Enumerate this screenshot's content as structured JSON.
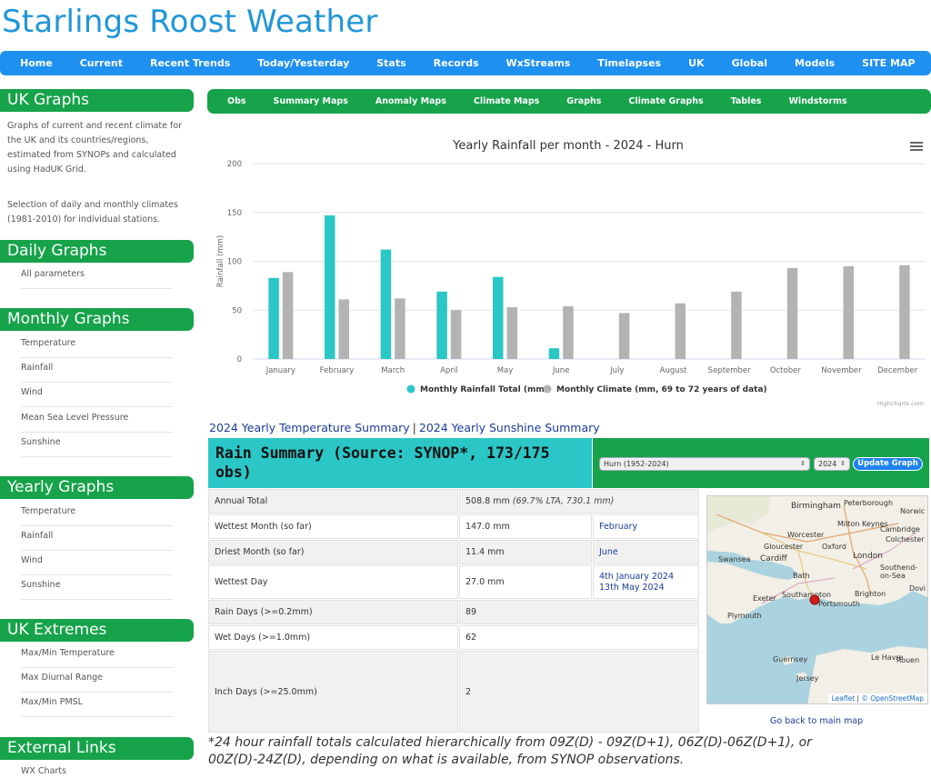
{
  "site_title": "Starlings Roost Weather",
  "topnav": [
    "Home",
    "Current",
    "Recent Trends",
    "Today/Yesterday",
    "Stats",
    "Records",
    "WxStreams",
    "Timelapses",
    "UK",
    "Global",
    "Models",
    "SITE MAP"
  ],
  "sidebar": {
    "uk_graphs": {
      "heading": "UK Graphs",
      "text1": "Graphs of current and recent climate for the UK and its countries/regions, estimated from SYNOPs and calculated using HadUK Grid.",
      "text2": "Selection of daily and monthly climates (1981-2010) for individual stations."
    },
    "daily": {
      "heading": "Daily Graphs",
      "items": [
        "All parameters"
      ]
    },
    "monthly": {
      "heading": "Monthly Graphs",
      "items": [
        "Temperature",
        "Rainfall",
        "Wind",
        "Mean Sea Level Pressure",
        "Sunshine"
      ]
    },
    "yearly": {
      "heading": "Yearly Graphs",
      "items": [
        "Temperature",
        "Rainfall",
        "Wind",
        "Sunshine"
      ]
    },
    "extremes": {
      "heading": "UK Extremes",
      "items": [
        "Max/Min Temperature",
        "Max Diurnal Range",
        "Max/Min PMSL"
      ]
    },
    "external": {
      "heading": "External Links",
      "items": [
        "WX Charts"
      ]
    }
  },
  "subnav": [
    "Obs",
    "Summary Maps",
    "Anomaly Maps",
    "Climate Maps",
    "Graphs",
    "Climate Graphs",
    "Tables",
    "Windstorms"
  ],
  "chart_data": {
    "type": "bar",
    "title": "Yearly Rainfall per month - 2024 - Hurn",
    "ylabel": "Rainfall (mm)",
    "xlabel": "",
    "ylim": [
      0,
      200
    ],
    "yticks": [
      0,
      50,
      100,
      150,
      200
    ],
    "categories": [
      "January",
      "February",
      "March",
      "April",
      "May",
      "June",
      "July",
      "August",
      "September",
      "October",
      "November",
      "December"
    ],
    "series": [
      {
        "name": "Monthly Rainfall Total (mm)",
        "color": "#2bc6c6",
        "values": [
          83,
          147,
          112,
          69,
          84,
          11,
          null,
          null,
          null,
          null,
          null,
          null
        ]
      },
      {
        "name": "Monthly Climate (mm, 69 to 72 years of data)",
        "color": "#b3b3b3",
        "values": [
          89,
          61,
          62,
          50,
          53,
          54,
          47,
          57,
          69,
          93,
          95,
          96
        ]
      }
    ],
    "legend": "bottom-center",
    "grid": true,
    "credit": "Highcharts.com"
  },
  "summary_links": {
    "temp": "2024 Yearly Temperature Summary",
    "sep": "|",
    "sun": "2024 Yearly Sunshine Summary"
  },
  "rain_summary": {
    "heading": "Rain Summary (Source: SYNOP*, 173/175 obs)",
    "station_select": "Hurn (1952-2024)",
    "year_select": "2024",
    "update_button": "Update Graph",
    "rows": {
      "annual_label": "Annual Total",
      "annual_value": "508.8 mm",
      "annual_lta": "(69.7% LTA, 730.1 mm)",
      "wettest_month_label": "Wettest Month (so far)",
      "wettest_month_value": "147.0 mm",
      "wettest_month_name": "February",
      "driest_month_label": "Driest Month (so far)",
      "driest_month_value": "11.4 mm",
      "driest_month_name": "June",
      "wettest_day_label": "Wettest Day",
      "wettest_day_value": "27.0 mm",
      "wettest_day_date1": "4th January 2024",
      "wettest_day_date2": "13th May 2024",
      "rain_days_label": "Rain Days (>=0.2mm)",
      "rain_days_value": "89",
      "wet_days_label": "Wet Days (>=1.0mm)",
      "wet_days_value": "62",
      "inch_days_label": "Inch Days (>=25.0mm)",
      "inch_days_value": "2"
    }
  },
  "map": {
    "labels": [
      "Birmingham",
      "Peterborough",
      "Norwic",
      "Worcester",
      "Milton Keynes",
      "Cambridge",
      "Colchester",
      "Gloucester",
      "Oxford",
      "Swansea",
      "Cardiff",
      "London",
      "Southend-on-Sea",
      "Bath",
      "Southampton",
      "Brighton",
      "Dovi",
      "Exeter",
      "Portsmouth",
      "Plymouth",
      "Guernsey",
      "Jersey",
      "Le Havre",
      "Rouen"
    ],
    "attribution_leaflet": "Leaflet",
    "attribution_sep": "|",
    "attribution_osm": "© OpenStreetMap",
    "marker_color": "#d11a1a"
  },
  "back_link": "Go back to main map",
  "footnote": "*24 hour rainfall totals calculated hierarchically from 09Z(D) - 09Z(D+1), 06Z(D)-06Z(D+1), or 00Z(D)-24Z(D), depending on what is available, from SYNOP observations."
}
